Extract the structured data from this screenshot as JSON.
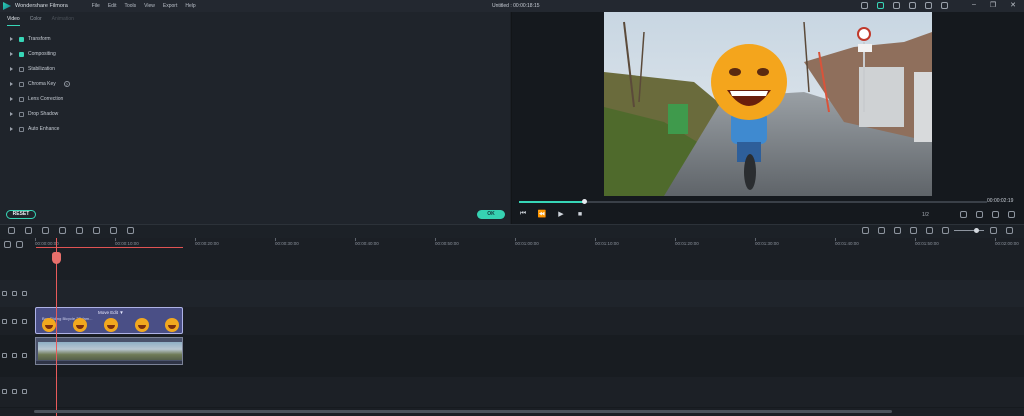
{
  "app": {
    "name": "Wondershare Filmora",
    "document_title": "Untitled : 00:00:18:15",
    "menu": [
      "File",
      "Edit",
      "Tools",
      "View",
      "Export",
      "Help"
    ]
  },
  "left_panel": {
    "tabs": [
      {
        "label": "Video",
        "state": "active"
      },
      {
        "label": "Color",
        "state": "normal"
      },
      {
        "label": "Animation",
        "state": "disabled"
      }
    ],
    "properties": [
      {
        "label": "Transform",
        "checked": true
      },
      {
        "label": "Compositing",
        "checked": true
      },
      {
        "label": "Stabilization",
        "checked": false
      },
      {
        "label": "Chroma Key",
        "checked": false,
        "help": true
      },
      {
        "label": "Lens Correction",
        "checked": false
      },
      {
        "label": "Drop Shadow",
        "checked": false
      },
      {
        "label": "Auto Enhance",
        "checked": false
      }
    ],
    "reset_label": "RESET",
    "ok_label": "OK"
  },
  "preview": {
    "timecode": "00:00:02:19",
    "progress": 0.14,
    "zoom_fraction": "1/2"
  },
  "timeline": {
    "ruler_ticks": [
      "00:00:00:00",
      "00:00:10:00",
      "00:00:20:00",
      "00:00:30:00",
      "00:00:40:00",
      "00:00:50:00",
      "00:01:00:00",
      "00:01:10:00",
      "00:01:20:00",
      "00:01:30:00",
      "00:01:40:00",
      "00:01:50:00",
      "00:02:00:00"
    ],
    "fx_clip_label": "Move Edit ▼",
    "fx_clip_sub": "Boy Riding Bicycle 2D fam..."
  },
  "colors": {
    "accent": "#37d6b7",
    "playhead": "#e85b5b",
    "fx_clip": "#4a4f86"
  }
}
